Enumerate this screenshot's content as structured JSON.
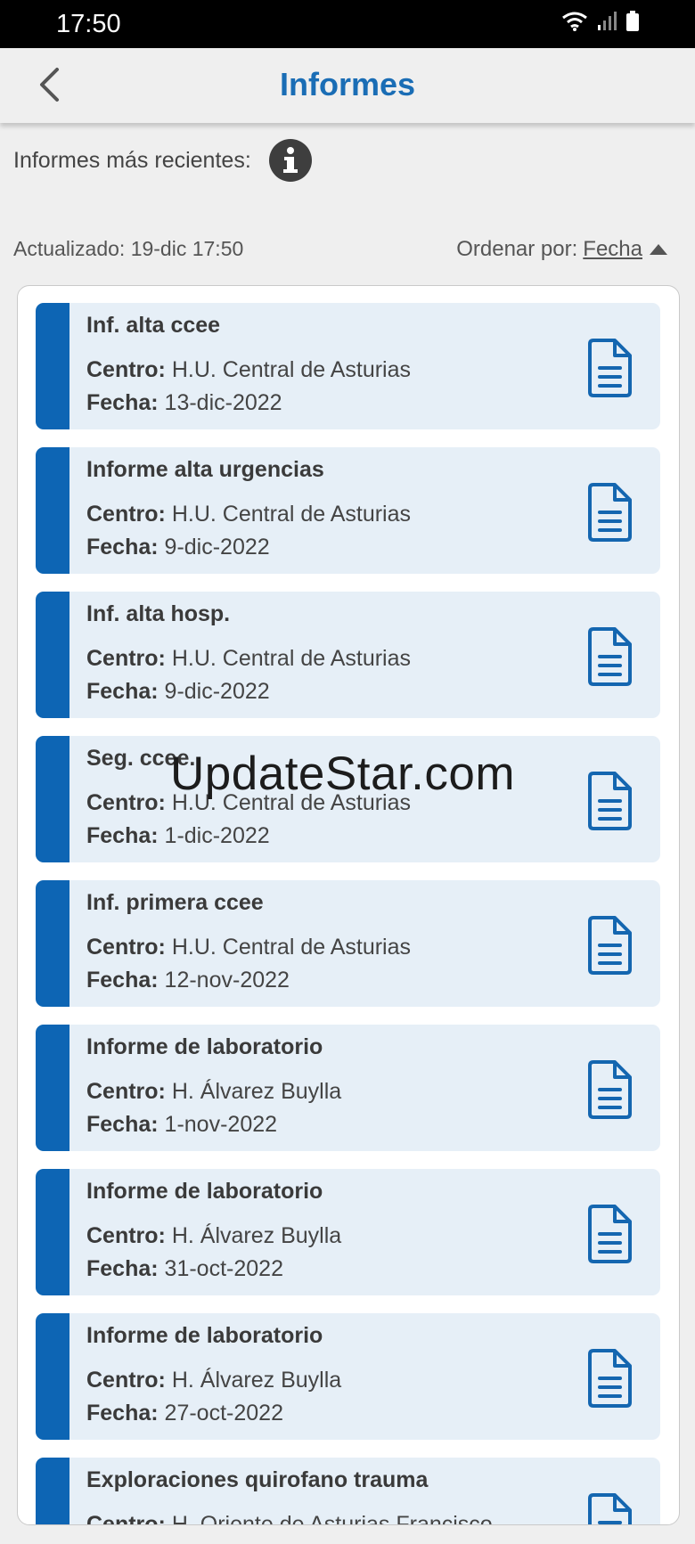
{
  "status_bar": {
    "time": "17:50"
  },
  "header": {
    "title": "Informes"
  },
  "recent": {
    "label": "Informes más recientes:"
  },
  "meta": {
    "updated": "Actualizado: 19-dic 17:50",
    "sort_label": "Ordenar por:",
    "sort_value": "Fecha"
  },
  "field_labels": {
    "center": "Centro:",
    "date": "Fecha:"
  },
  "reports": [
    {
      "title": "Inf. alta ccee",
      "center": "H.U. Central de Asturias",
      "date": "13-dic-2022"
    },
    {
      "title": "Informe alta urgencias",
      "center": "H.U. Central de Asturias",
      "date": "9-dic-2022"
    },
    {
      "title": "Inf. alta hosp.",
      "center": "H.U. Central de Asturias",
      "date": "9-dic-2022"
    },
    {
      "title": "Seg. ccee.",
      "center": "H.U. Central de Asturias",
      "date": "1-dic-2022"
    },
    {
      "title": "Inf. primera ccee",
      "center": "H.U. Central de Asturias",
      "date": "12-nov-2022"
    },
    {
      "title": "Informe de laboratorio",
      "center": "H. Álvarez Buylla",
      "date": "1-nov-2022"
    },
    {
      "title": "Informe de laboratorio",
      "center": "H. Álvarez Buylla",
      "date": "31-oct-2022"
    },
    {
      "title": "Informe de laboratorio",
      "center": "H. Álvarez Buylla",
      "date": "27-oct-2022"
    },
    {
      "title": "Exploraciones quirofano trauma",
      "center": "H. Oriente de Asturias Francisco",
      "date": ""
    }
  ],
  "watermark": "UpdateStar.com",
  "colors": {
    "accent": "#0d65b4",
    "title": "#1a6db5",
    "card_bg": "#e6eff7"
  }
}
